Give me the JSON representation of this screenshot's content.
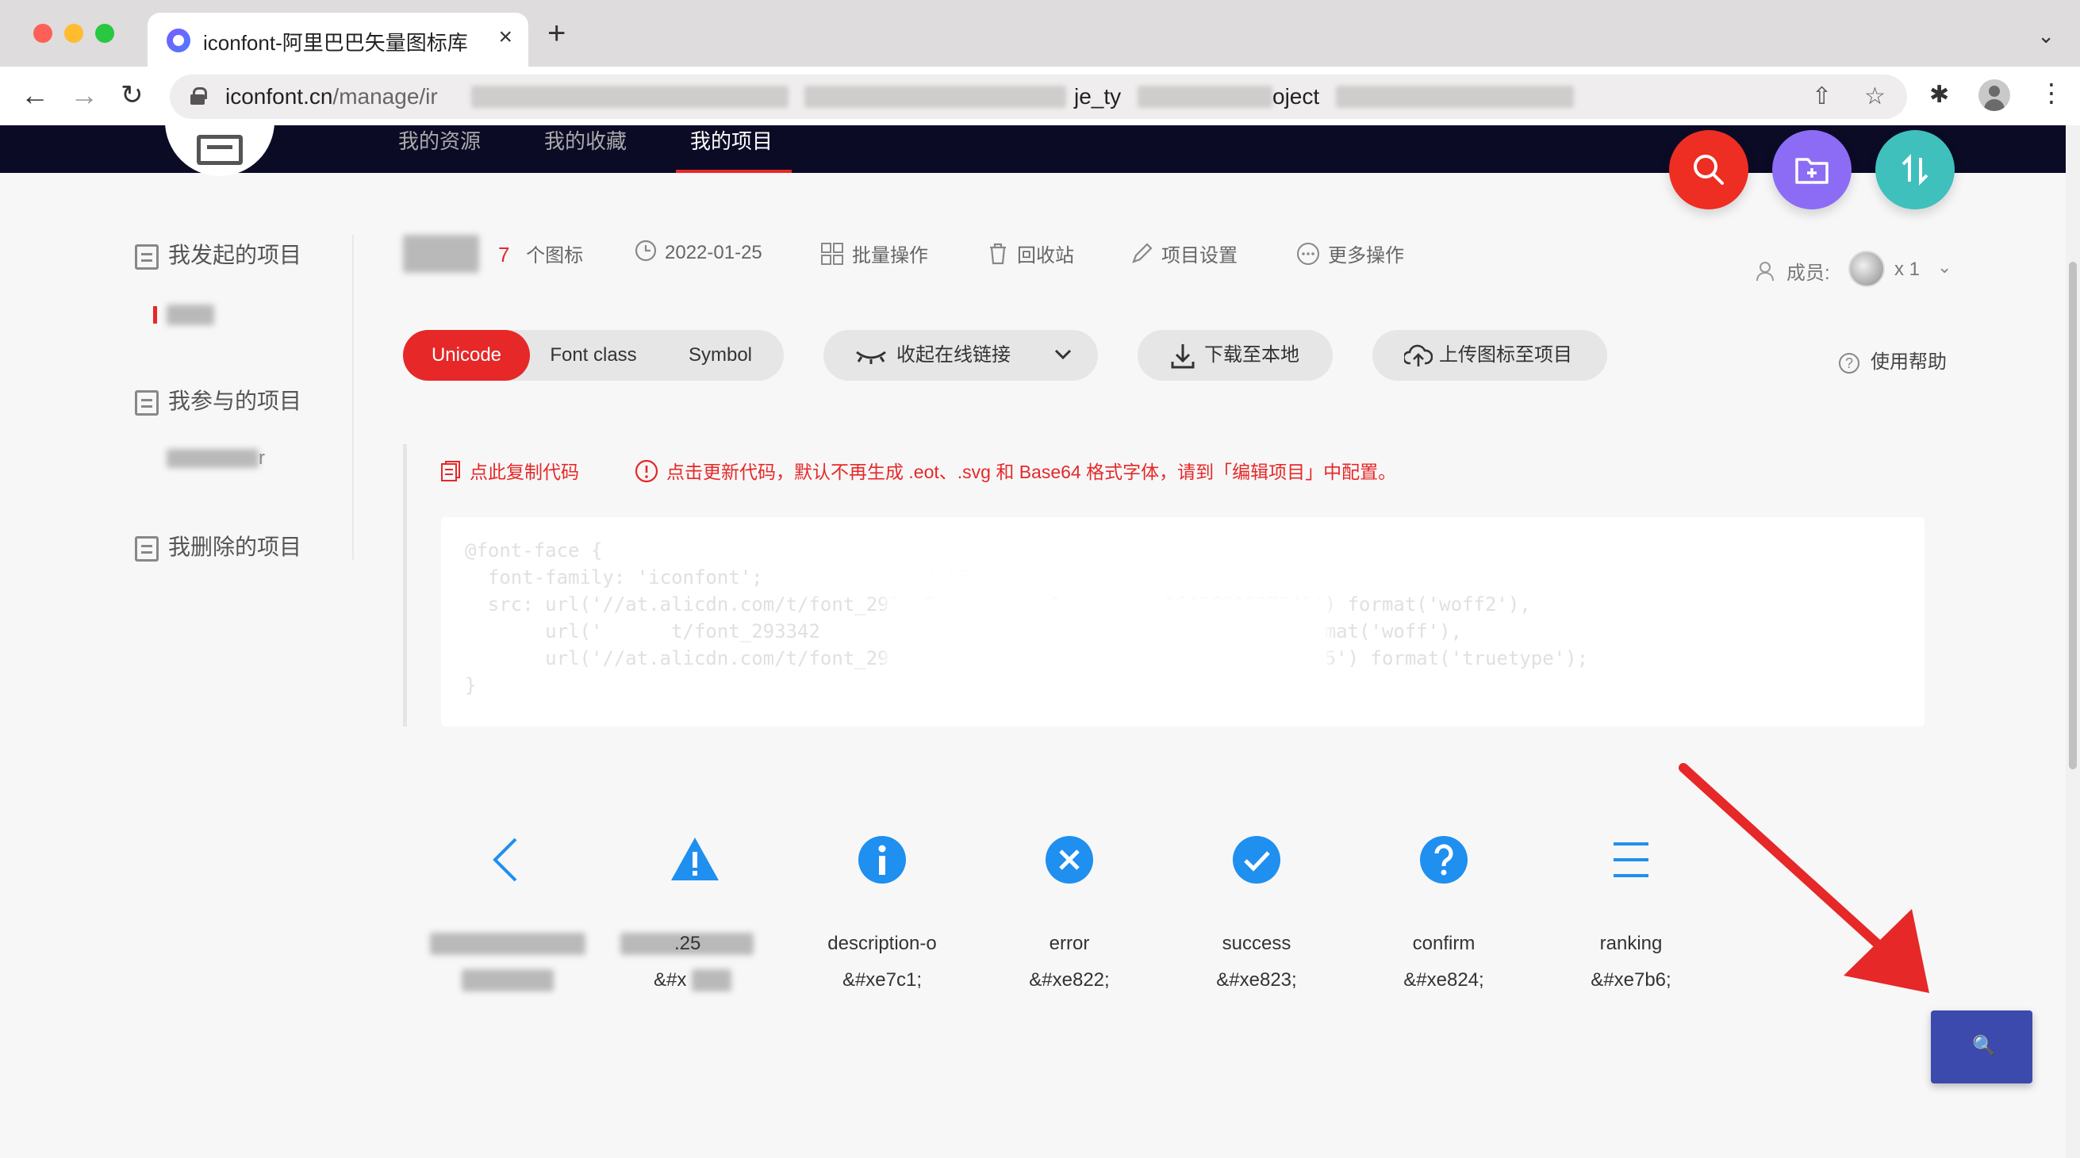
{
  "browser": {
    "tab_title": "iconfont-阿里巴巴矢量图标库",
    "tab_close": "×",
    "new_tab": "+",
    "url_domain": "iconfont.cn",
    "url_path": "/manage/ir",
    "url_frag1": "je_ty",
    "url_frag2": "oject"
  },
  "header": {
    "nav": [
      "我的资源",
      "我的收藏",
      "我的项目"
    ]
  },
  "sidebar": {
    "sections": [
      "我发起的项目",
      "我参与的项目",
      "我删除的项目"
    ],
    "participated_suffix": "r"
  },
  "project": {
    "icon_count": "7",
    "icon_count_label": "个图标",
    "date": "2022-01-25",
    "actions": [
      "批量操作",
      "回收站",
      "项目设置",
      "更多操作"
    ],
    "members_label": "成员:",
    "members_count": "x 1"
  },
  "tabs": {
    "items": [
      "Unicode",
      "Font class",
      "Symbol"
    ],
    "active": "Unicode"
  },
  "buttons": {
    "collapse_link": "收起在线链接",
    "download": "下载至本地",
    "upload": "上传图标至项目",
    "help": "使用帮助"
  },
  "notices": {
    "copy": "点此复制代码",
    "update": "点击更新代码，默认不再生成 .eot、.svg 和 Base64 格式字体，请到「编辑项目」中配置。"
  },
  "code": {
    "lines": [
      "@font-face {",
      "  font-family: 'iconfont';  /* project id 293",
      "  src: url('//at.alicdn.com/t/font_293__5_ro       0.wo     =1643696037245') format('woff2'),",
      "       url('      t/font_293342                8.woff?t=1643696037245') format('woff'),",
      "       url('//at.alicdn.com/t/font_293342      5h7v6a22 .ttf?t=1643696037245') format('truetype');",
      "}"
    ]
  },
  "icons": [
    {
      "name": "",
      "code": ""
    },
    {
      "name": ".25",
      "code": "&#x"
    },
    {
      "name": "description-o",
      "code": "&#xe7c1;"
    },
    {
      "name": "error",
      "code": "&#xe822;"
    },
    {
      "name": "success",
      "code": "&#xe823;"
    },
    {
      "name": "confirm",
      "code": "&#xe824;"
    },
    {
      "name": "ranking",
      "code": "&#xe7b6;"
    }
  ],
  "icon_names": [
    "chevron-left-icon",
    "warning-icon",
    "info-icon",
    "error-icon",
    "success-icon",
    "confirm-icon",
    "ranking-icon"
  ],
  "colors": {
    "brand_red": "#e62828",
    "icon_blue": "#1f8ff0",
    "header_dark": "#0c0b26",
    "search_btn": "#3b4aac"
  }
}
